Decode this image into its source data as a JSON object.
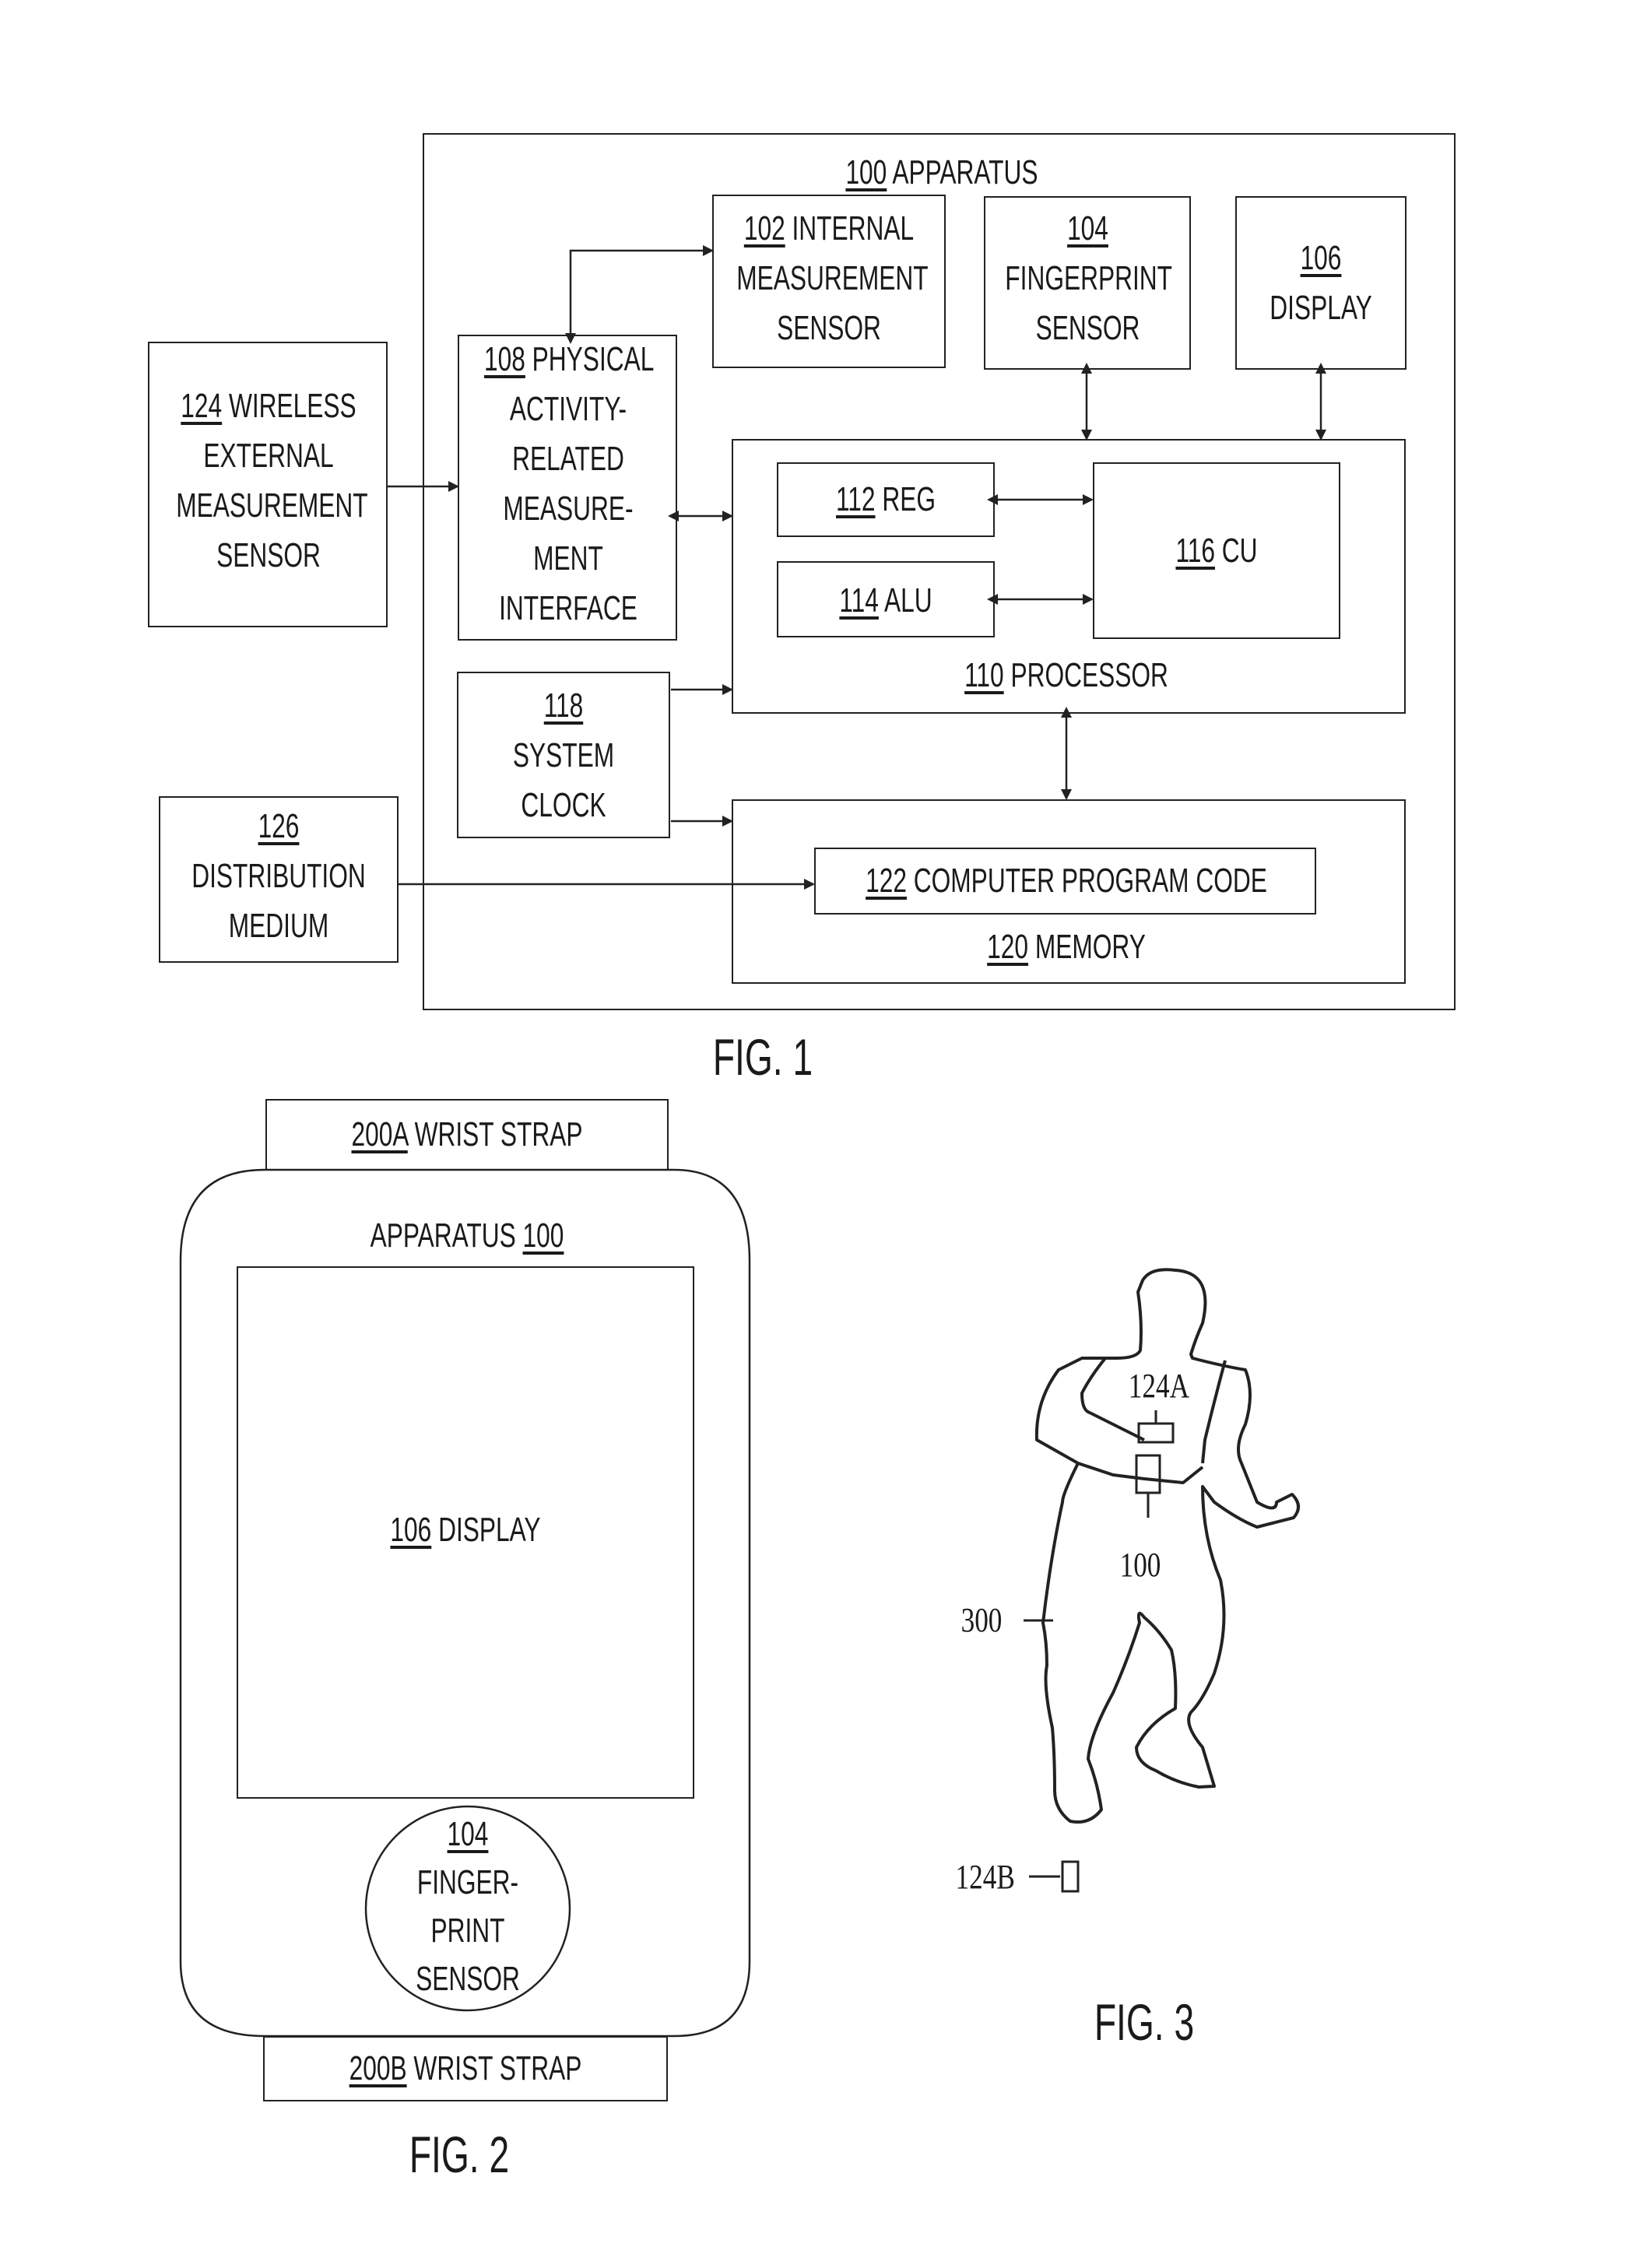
{
  "fig1": {
    "caption": "FIG. 1",
    "apparatus": {
      "num": "100",
      "label": "APPARATUS"
    },
    "internal_sensor": {
      "num": "102",
      "line1": "INTERNAL",
      "line2": "MEASUREMENT",
      "line3": "SENSOR"
    },
    "fingerprint_sensor": {
      "num": "104",
      "line1": "FINGERPRINT",
      "line2": "SENSOR"
    },
    "display": {
      "num": "106",
      "line1": "DISPLAY"
    },
    "interface": {
      "num": "108",
      "line1": "PHYSICAL",
      "line2": "ACTIVITY-",
      "line3": "RELATED",
      "line4": "MEASURE-",
      "line5": "MENT",
      "line6": "INTERFACE"
    },
    "processor": {
      "num": "110",
      "label": "PROCESSOR"
    },
    "reg": {
      "num": "112",
      "label": "REG"
    },
    "alu": {
      "num": "114",
      "label": "ALU"
    },
    "cu": {
      "num": "116",
      "label": "CU"
    },
    "clock": {
      "num": "118",
      "line1": "SYSTEM",
      "line2": "CLOCK"
    },
    "memory": {
      "num": "120",
      "label": "MEMORY"
    },
    "code": {
      "num": "122",
      "label": "COMPUTER PROGRAM CODE"
    },
    "wireless_sensor": {
      "num": "124",
      "line1": "WIRELESS",
      "line2": "EXTERNAL",
      "line3": "MEASUREMENT",
      "line4": "SENSOR"
    },
    "distribution": {
      "num": "126",
      "line1": "DISTRIBUTION",
      "line2": "MEDIUM"
    }
  },
  "fig2": {
    "caption": "FIG. 2",
    "strap_top": {
      "num": "200A",
      "label": "WRIST STRAP"
    },
    "apparatus": {
      "label": "APPARATUS",
      "num": "100"
    },
    "display": {
      "num": "106",
      "label": "DISPLAY"
    },
    "fingerprint": {
      "num": "104",
      "line1": "FINGER-",
      "line2": "PRINT",
      "line3": "SENSOR"
    },
    "strap_bottom": {
      "num": "200B",
      "label": "WRIST STRAP"
    }
  },
  "fig3": {
    "caption": "FIG. 3",
    "sensor_chest": "124A",
    "apparatus": "100",
    "user": "300",
    "sensor_ankle": "124B"
  }
}
